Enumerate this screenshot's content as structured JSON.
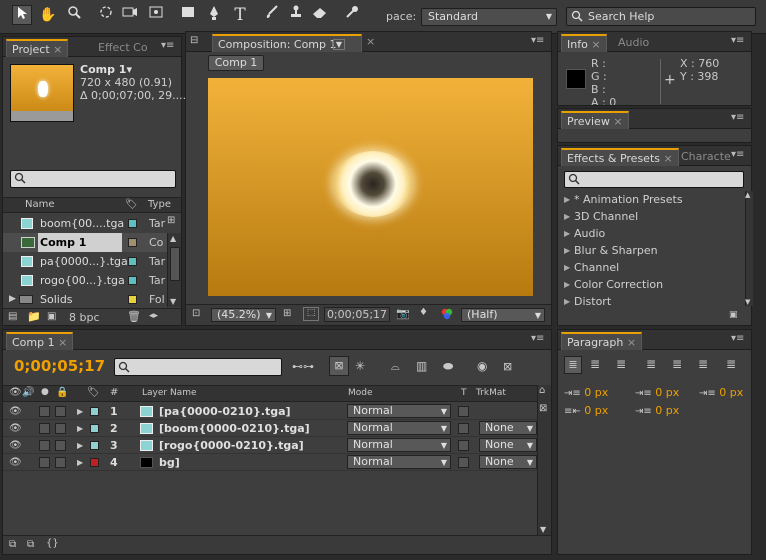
{
  "toolbar": {
    "workspace_label": "pace:",
    "workspace_value": "Standard",
    "search_placeholder": "Search Help"
  },
  "project_panel": {
    "tabs": [
      "Project",
      "Effect Co"
    ],
    "preview_name": "Comp 1▾",
    "preview_size": "720 x 480 (0.91)",
    "preview_duration": "Δ 0;00;07;00, 29....",
    "col_name": "Name",
    "col_type": "Type",
    "items": [
      {
        "name": "boom{00....tga",
        "type": "Tar",
        "swatch": "#5fbfbf",
        "kind": "footage"
      },
      {
        "name": "Comp 1",
        "type": "Co",
        "swatch": "#a09070",
        "kind": "comp"
      },
      {
        "name": "pa{0000...}.tga",
        "type": "Tar",
        "swatch": "#5fbfbf",
        "kind": "footage"
      },
      {
        "name": "rogo{00...}.tga",
        "type": "Tar",
        "swatch": "#5fbfbf",
        "kind": "footage"
      },
      {
        "name": "Solids",
        "type": "Fol",
        "swatch": "#e8d040",
        "kind": "folder"
      }
    ],
    "bpc": "8 bpc"
  },
  "composition_panel": {
    "tab_label": "Composition: Comp 1",
    "comp_button": "Comp 1",
    "zoom": "(45.2%)",
    "timecode": "0;00;05;17",
    "resolution": "(Half)"
  },
  "info_panel": {
    "tabs": [
      "Info",
      "Audio"
    ],
    "r": "R :",
    "g": "G :",
    "b": "B :",
    "a": "A : 0",
    "x": "X : 760",
    "y": "Y : 398"
  },
  "preview_panel": {
    "tab": "Preview"
  },
  "effects_panel": {
    "tabs": [
      "Effects & Presets",
      "Characte"
    ],
    "items": [
      "* Animation Presets",
      "3D Channel",
      "Audio",
      "Blur & Sharpen",
      "Channel",
      "Color Correction",
      "Distort"
    ]
  },
  "timeline_panel": {
    "tab": "Comp 1",
    "timecode": "0;00;05;17",
    "col_layer_name": "Layer Name",
    "col_mode": "Mode",
    "col_t": "T",
    "col_trkmat": "TrkMat",
    "col_num": "#",
    "layers": [
      {
        "num": "1",
        "name": "[pa{0000-0210}.tga]",
        "mode": "Normal",
        "trkmat": "",
        "label": "#8fd0d0",
        "thumb": "footage"
      },
      {
        "num": "2",
        "name": "[boom{0000-0210}.tga]",
        "mode": "Normal",
        "trkmat": "None",
        "label": "#8fd0d0",
        "thumb": "footage"
      },
      {
        "num": "3",
        "name": "[rogo{0000-0210}.tga]",
        "mode": "Normal",
        "trkmat": "None",
        "label": "#8fd0d0",
        "thumb": "footage"
      },
      {
        "num": "4",
        "name": "bg]",
        "mode": "Normal",
        "trkmat": "None",
        "label": "#c02020",
        "thumb": "solid"
      }
    ]
  },
  "paragraph_panel": {
    "tab": "Paragraph",
    "indent_left": "0 px",
    "indent_first": "0 px",
    "space_before": "0 px",
    "indent_right": "0 px",
    "space_after": "0 px"
  },
  "colors": {
    "accent": "#f0a000",
    "comp_bg_top": "#f2b23a",
    "comp_bg_bottom": "#b67a10"
  }
}
